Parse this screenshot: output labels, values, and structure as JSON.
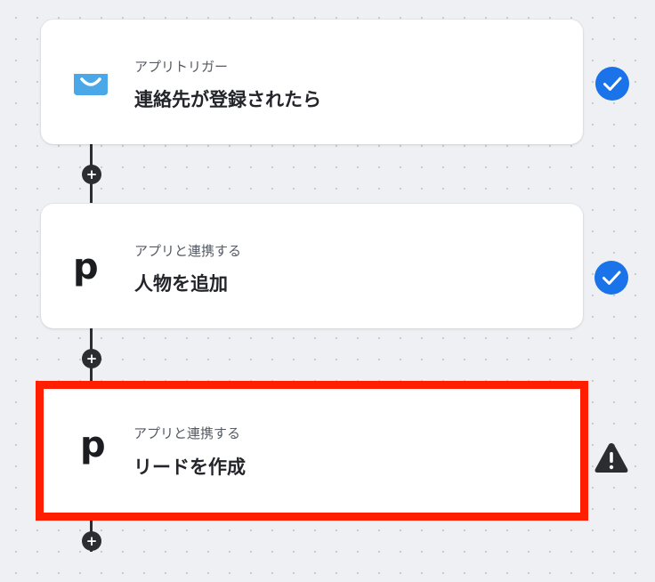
{
  "steps": [
    {
      "subtitle": "アプリトリガー",
      "title": "連絡先が登録されたら",
      "app_icon": "getresponse-mail-icon",
      "status": "complete",
      "status_icon": "check-circle-icon"
    },
    {
      "subtitle": "アプリと連携する",
      "title": "人物を追加",
      "app_icon": "pipedrive-p-icon",
      "app_icon_glyph": "p",
      "status": "complete",
      "status_icon": "check-circle-icon"
    },
    {
      "subtitle": "アプリと連携する",
      "title": "リードを作成",
      "app_icon": "pipedrive-p-icon",
      "app_icon_glyph": "p",
      "status": "warning",
      "status_icon": "warning-icon",
      "selected": true
    }
  ],
  "add_button_label": "+",
  "colors": {
    "check": "#1a73e8",
    "warning": "#2b2d31",
    "highlight": "#ff1e00",
    "mail_icon": "#4aa8e8"
  }
}
